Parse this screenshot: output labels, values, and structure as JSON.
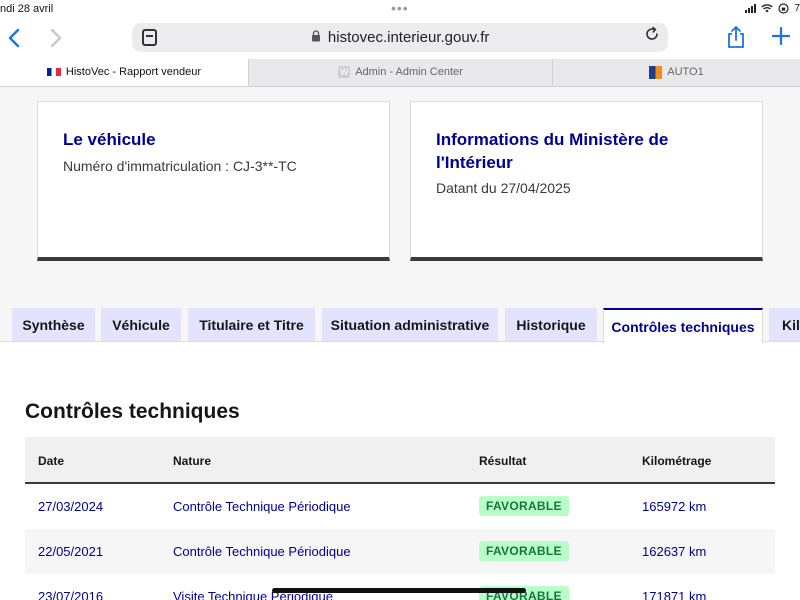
{
  "status_bar": {
    "date": "ndi 28 avril",
    "dots": "•••",
    "battery": "7"
  },
  "browser": {
    "url": "histovec.interieur.gouv.fr",
    "icons": {
      "back": "chevron-left-icon",
      "forward": "chevron-right-icon",
      "tabs": "tab-overview-icon",
      "lock": "lock-icon",
      "reload": "reload-icon",
      "share": "share-icon",
      "new_tab": "plus-icon"
    },
    "tabs": [
      {
        "label": "HistoVec - Rapport vendeur",
        "favicon": "french-flag-icon",
        "active": true
      },
      {
        "label": "Admin - Admin Center",
        "favicon": "w-favicon-icon",
        "active": false
      },
      {
        "label": "AUTO1",
        "favicon": "auto1-favicon-icon",
        "active": false
      }
    ]
  },
  "cards": {
    "vehicle": {
      "title": "Le véhicule",
      "plate": "Numéro d'immatriculation : CJ-3**-TC"
    },
    "ministry": {
      "title_line1": "Informations du Ministère de",
      "title_line2": "l'Intérieur",
      "date": "Datant du 27/04/2025"
    }
  },
  "report_tabs": [
    {
      "label": "Synthèse",
      "selected": false
    },
    {
      "label": "Véhicule",
      "selected": false
    },
    {
      "label": "Titulaire et Titre",
      "selected": false
    },
    {
      "label": "Situation administrative",
      "selected": false
    },
    {
      "label": "Historique",
      "selected": false
    },
    {
      "label": "Contrôles techniques",
      "selected": true
    },
    {
      "label": "Kil",
      "selected": false
    }
  ],
  "controls": {
    "title": "Contrôles techniques",
    "columns": [
      "Date",
      "Nature",
      "Résultat",
      "Kilométrage"
    ],
    "rows": [
      {
        "date": "27/03/2024",
        "nature": "Contrôle Technique Périodique",
        "result": "FAVORABLE",
        "km": "165972 km"
      },
      {
        "date": "22/05/2021",
        "nature": "Contrôle Technique Périodique",
        "result": "FAVORABLE",
        "km": "162637 km"
      },
      {
        "date": "23/07/2016",
        "nature": "Visite Technique Périodique",
        "result": "FAVORABLE",
        "km": "171871 km"
      }
    ]
  },
  "colors": {
    "brand_blue": "#000091",
    "tab_bg": "#e3e3fd",
    "badge_text": "#18753c",
    "badge_bg": "#b8fec9",
    "safari_blue": "#1a73e8"
  }
}
